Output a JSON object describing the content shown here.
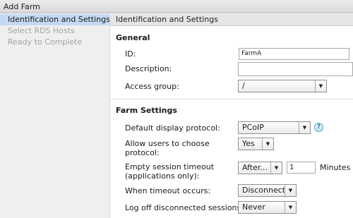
{
  "window": {
    "title": "Add Farm"
  },
  "sidebar": {
    "steps": [
      {
        "label": "Identification and Settings"
      },
      {
        "label": "Select RDS Hosts"
      },
      {
        "label": "Ready to Complete"
      }
    ]
  },
  "main": {
    "header": "Identification and Settings",
    "general": {
      "title": "General",
      "id_label": "ID:",
      "id_value": "FarmA",
      "description_label": "Description:",
      "description_value": "",
      "access_group_label": "Access group:",
      "access_group_value": "/"
    },
    "farm_settings": {
      "title": "Farm Settings",
      "protocol_label": "Default display protocol:",
      "protocol_value": "PCoIP",
      "allow_choose_label_line1": "Allow users to choose",
      "allow_choose_label_line2": "protocol:",
      "allow_choose_value": "Yes",
      "empty_timeout_label_line1": "Empty session timeout",
      "empty_timeout_label_line2": "(applications only):",
      "empty_timeout_mode": "After...",
      "empty_timeout_value": "1",
      "empty_timeout_unit": "Minutes",
      "when_timeout_label": "When timeout occurs:",
      "when_timeout_value": "Disconnect",
      "logoff_label": "Log off disconnected sessions:",
      "logoff_value": "Never"
    }
  },
  "icons": {
    "dropdown_arrow": "▼",
    "help": "?"
  }
}
